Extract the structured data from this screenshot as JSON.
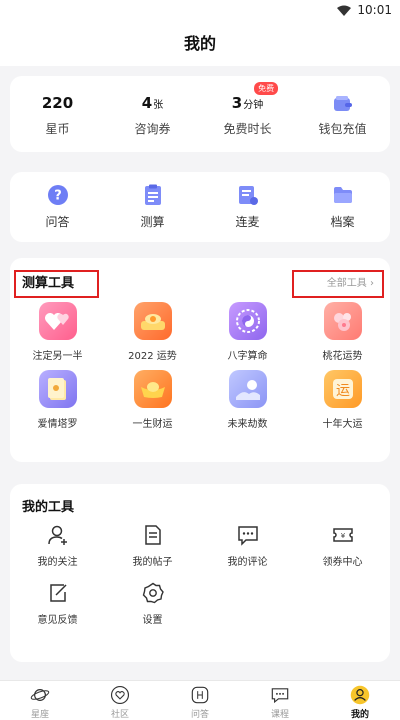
{
  "status_bar": {
    "time": "10:01"
  },
  "header": {
    "title": "我的"
  },
  "stats": [
    {
      "value": "220",
      "unit": "",
      "label": "星币"
    },
    {
      "value": "4",
      "unit": "张",
      "label": "咨询券"
    },
    {
      "value": "3",
      "unit": "分钟",
      "label": "免费时长",
      "badge": "免费"
    },
    {
      "icon": "wallet-icon",
      "label": "钱包充值"
    }
  ],
  "quick": [
    {
      "icon": "question-icon",
      "label": "问答"
    },
    {
      "icon": "calculate-icon",
      "label": "测算"
    },
    {
      "icon": "connect-mic-icon",
      "label": "连麦"
    },
    {
      "icon": "folder-icon",
      "label": "档案"
    }
  ],
  "tools": {
    "title": "测算工具",
    "all_label": "全部工具 ›",
    "items": [
      {
        "label": "注定另一半",
        "icon": "hearts-icon",
        "color": "#ff6e9a"
      },
      {
        "label": "2022 运势",
        "icon": "fortune-2022-icon",
        "color": "#ff7a3c"
      },
      {
        "label": "八字算命",
        "icon": "bazi-icon",
        "color": "#a77cf4"
      },
      {
        "label": "桃花运势",
        "icon": "peach-blossom-icon",
        "color": "#ff8d88"
      },
      {
        "label": "爱情塔罗",
        "icon": "tarot-icon",
        "color": "#9a8cf8"
      },
      {
        "label": "一生财运",
        "icon": "gold-ingot-icon",
        "color": "#ff8a30"
      },
      {
        "label": "未来劫数",
        "icon": "future-icon",
        "color": "#8f9ef8"
      },
      {
        "label": "十年大运",
        "icon": "luck-icon",
        "color": "#ffa53a"
      }
    ]
  },
  "my_tools": {
    "title": "我的工具",
    "items": [
      {
        "label": "我的关注",
        "icon": "follow-icon"
      },
      {
        "label": "我的帖子",
        "icon": "posts-icon"
      },
      {
        "label": "我的评论",
        "icon": "comment-icon"
      },
      {
        "label": "领券中心",
        "icon": "coupon-icon"
      },
      {
        "label": "意见反馈",
        "icon": "feedback-icon"
      },
      {
        "label": "设置",
        "icon": "settings-icon"
      }
    ]
  },
  "bottom_nav": [
    {
      "label": "星座",
      "icon": "planet-icon",
      "active": false
    },
    {
      "label": "社区",
      "icon": "community-icon",
      "active": false
    },
    {
      "label": "问答",
      "icon": "qa-icon",
      "active": false
    },
    {
      "label": "课程",
      "icon": "course-icon",
      "active": false
    },
    {
      "label": "我的",
      "icon": "profile-icon",
      "active": true
    }
  ],
  "colors": {
    "highlight_box": "#e02020",
    "badge": "#ff4a4a",
    "active_nav": "#f7c52b"
  }
}
